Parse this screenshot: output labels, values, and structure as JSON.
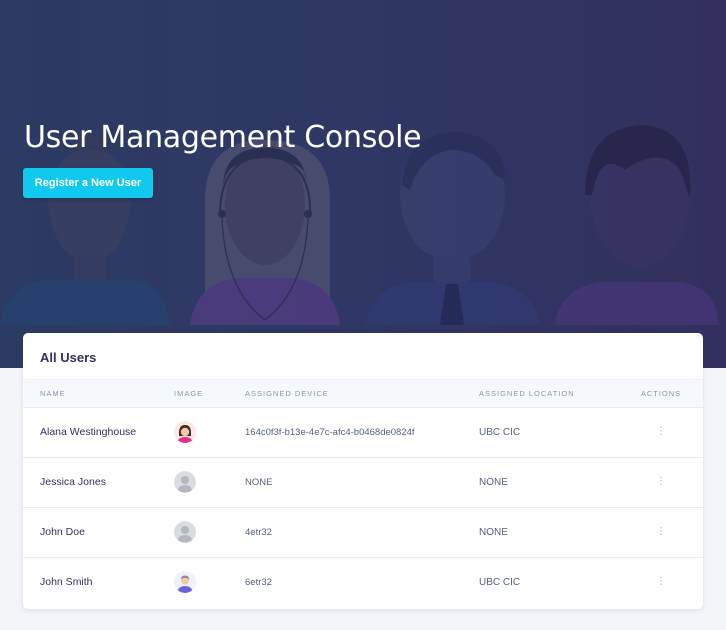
{
  "hero": {
    "title": "User Management Console",
    "register_button": "Register a New User"
  },
  "users_card": {
    "title": "All Users",
    "columns": [
      "NAME",
      "IMAGE",
      "ASSIGNED DEVICE",
      "ASSIGNED LOCATION",
      "ACTIONS"
    ],
    "rows": [
      {
        "name": "Alana Westinghouse",
        "avatar": "female-avatar",
        "device": "164c0f3f-b13e-4e7c-afc4-b0468de0824f",
        "location": "UBC CIC"
      },
      {
        "name": "Jessica Jones",
        "avatar": "default-avatar",
        "device": "NONE",
        "location": "NONE"
      },
      {
        "name": "John Doe",
        "avatar": "default-avatar",
        "device": "4etr32",
        "location": "NONE"
      },
      {
        "name": "John Smith",
        "avatar": "male-avatar",
        "device": "6etr32",
        "location": "UBC CIC"
      }
    ],
    "actions_icon": "more-vertical-icon"
  },
  "colors": {
    "accent": "#11c9ef",
    "hero_bg": "#2f3764",
    "heading": "#32325d"
  }
}
